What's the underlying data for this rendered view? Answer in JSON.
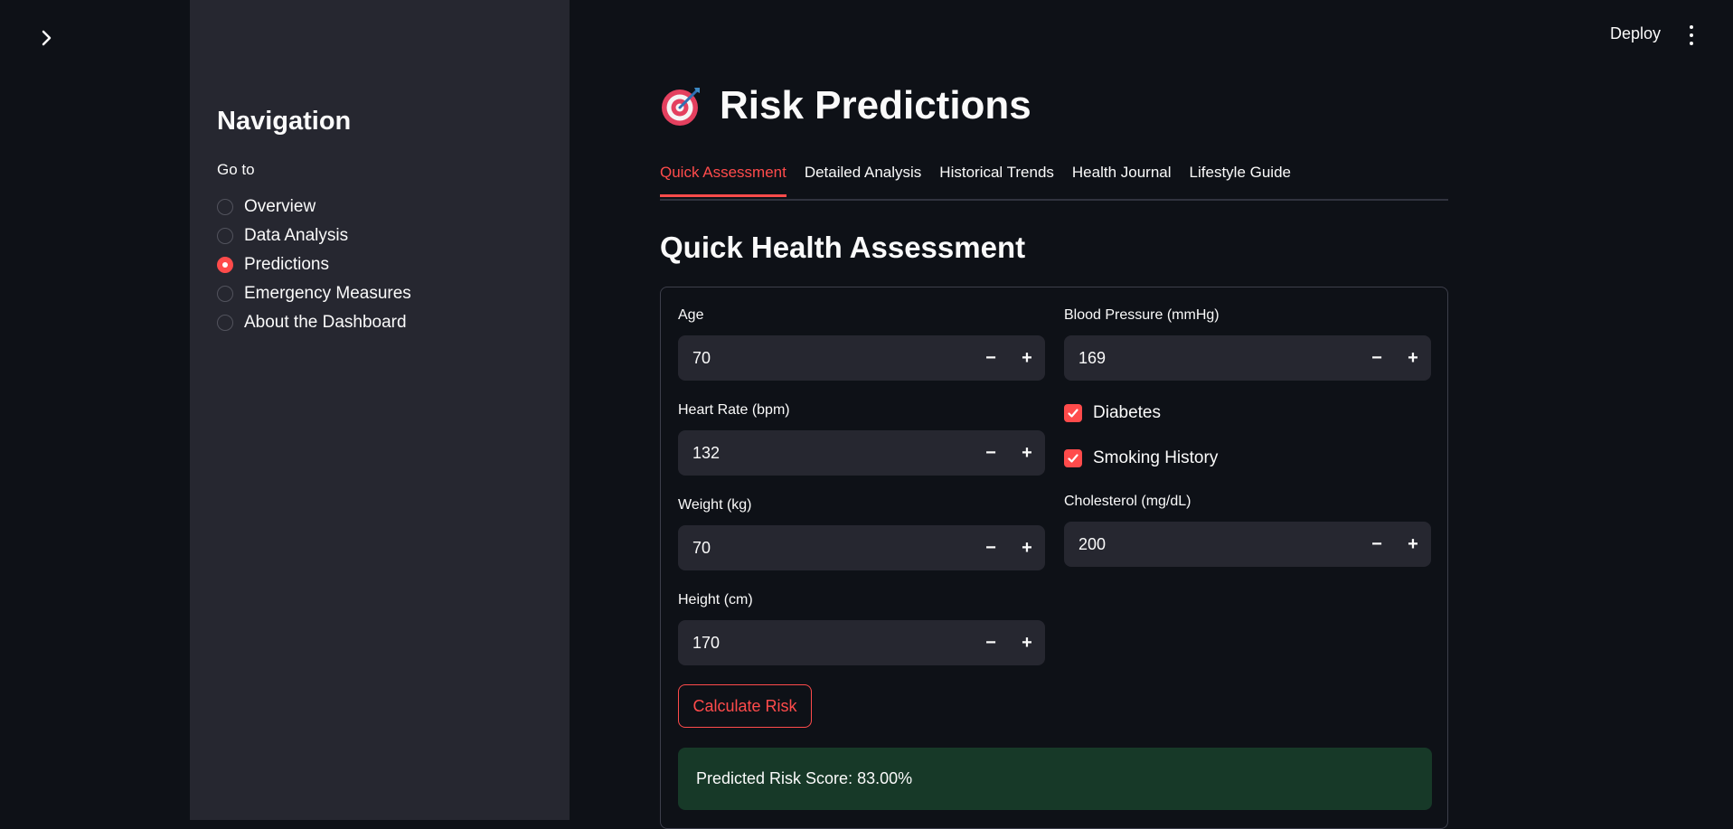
{
  "app": {
    "deploy_label": "Deploy",
    "menu_icon": "vertical-ellipsis-icon",
    "collapse_icon": "chevron-right-icon"
  },
  "sidebar": {
    "title": "Navigation",
    "radio_group_label": "Go to",
    "items": [
      {
        "label": "Overview",
        "selected": false
      },
      {
        "label": "Data Analysis",
        "selected": false
      },
      {
        "label": "Predictions",
        "selected": true
      },
      {
        "label": "Emergency Measures",
        "selected": false
      },
      {
        "label": "About the Dashboard",
        "selected": false
      }
    ]
  },
  "page": {
    "title": "Risk Predictions",
    "title_icon": "target-icon",
    "tabs": [
      {
        "label": "Quick Assessment",
        "active": true
      },
      {
        "label": "Detailed Analysis",
        "active": false
      },
      {
        "label": "Historical Trends",
        "active": false
      },
      {
        "label": "Health Journal",
        "active": false
      },
      {
        "label": "Lifestyle Guide",
        "active": false
      }
    ],
    "section_title": "Quick Health Assessment"
  },
  "form": {
    "age": {
      "label": "Age",
      "value": "70"
    },
    "heart_rate": {
      "label": "Heart Rate (bpm)",
      "value": "132"
    },
    "weight": {
      "label": "Weight (kg)",
      "value": "70"
    },
    "height": {
      "label": "Height (cm)",
      "value": "170"
    },
    "blood_pressure": {
      "label": "Blood Pressure (mmHg)",
      "value": "169"
    },
    "diabetes": {
      "label": "Diabetes",
      "checked": true
    },
    "smoking": {
      "label": "Smoking History",
      "checked": true
    },
    "cholesterol": {
      "label": "Cholesterol (mg/dL)",
      "value": "200"
    },
    "stepper_minus": "−",
    "stepper_plus": "+",
    "calculate_button": "Calculate Risk"
  },
  "result": {
    "text": "Predicted Risk Score: 83.00%"
  },
  "colors": {
    "accent": "#ff4b4b",
    "background": "#0e1117",
    "sidebar": "#262730",
    "success_bg": "#173928"
  }
}
